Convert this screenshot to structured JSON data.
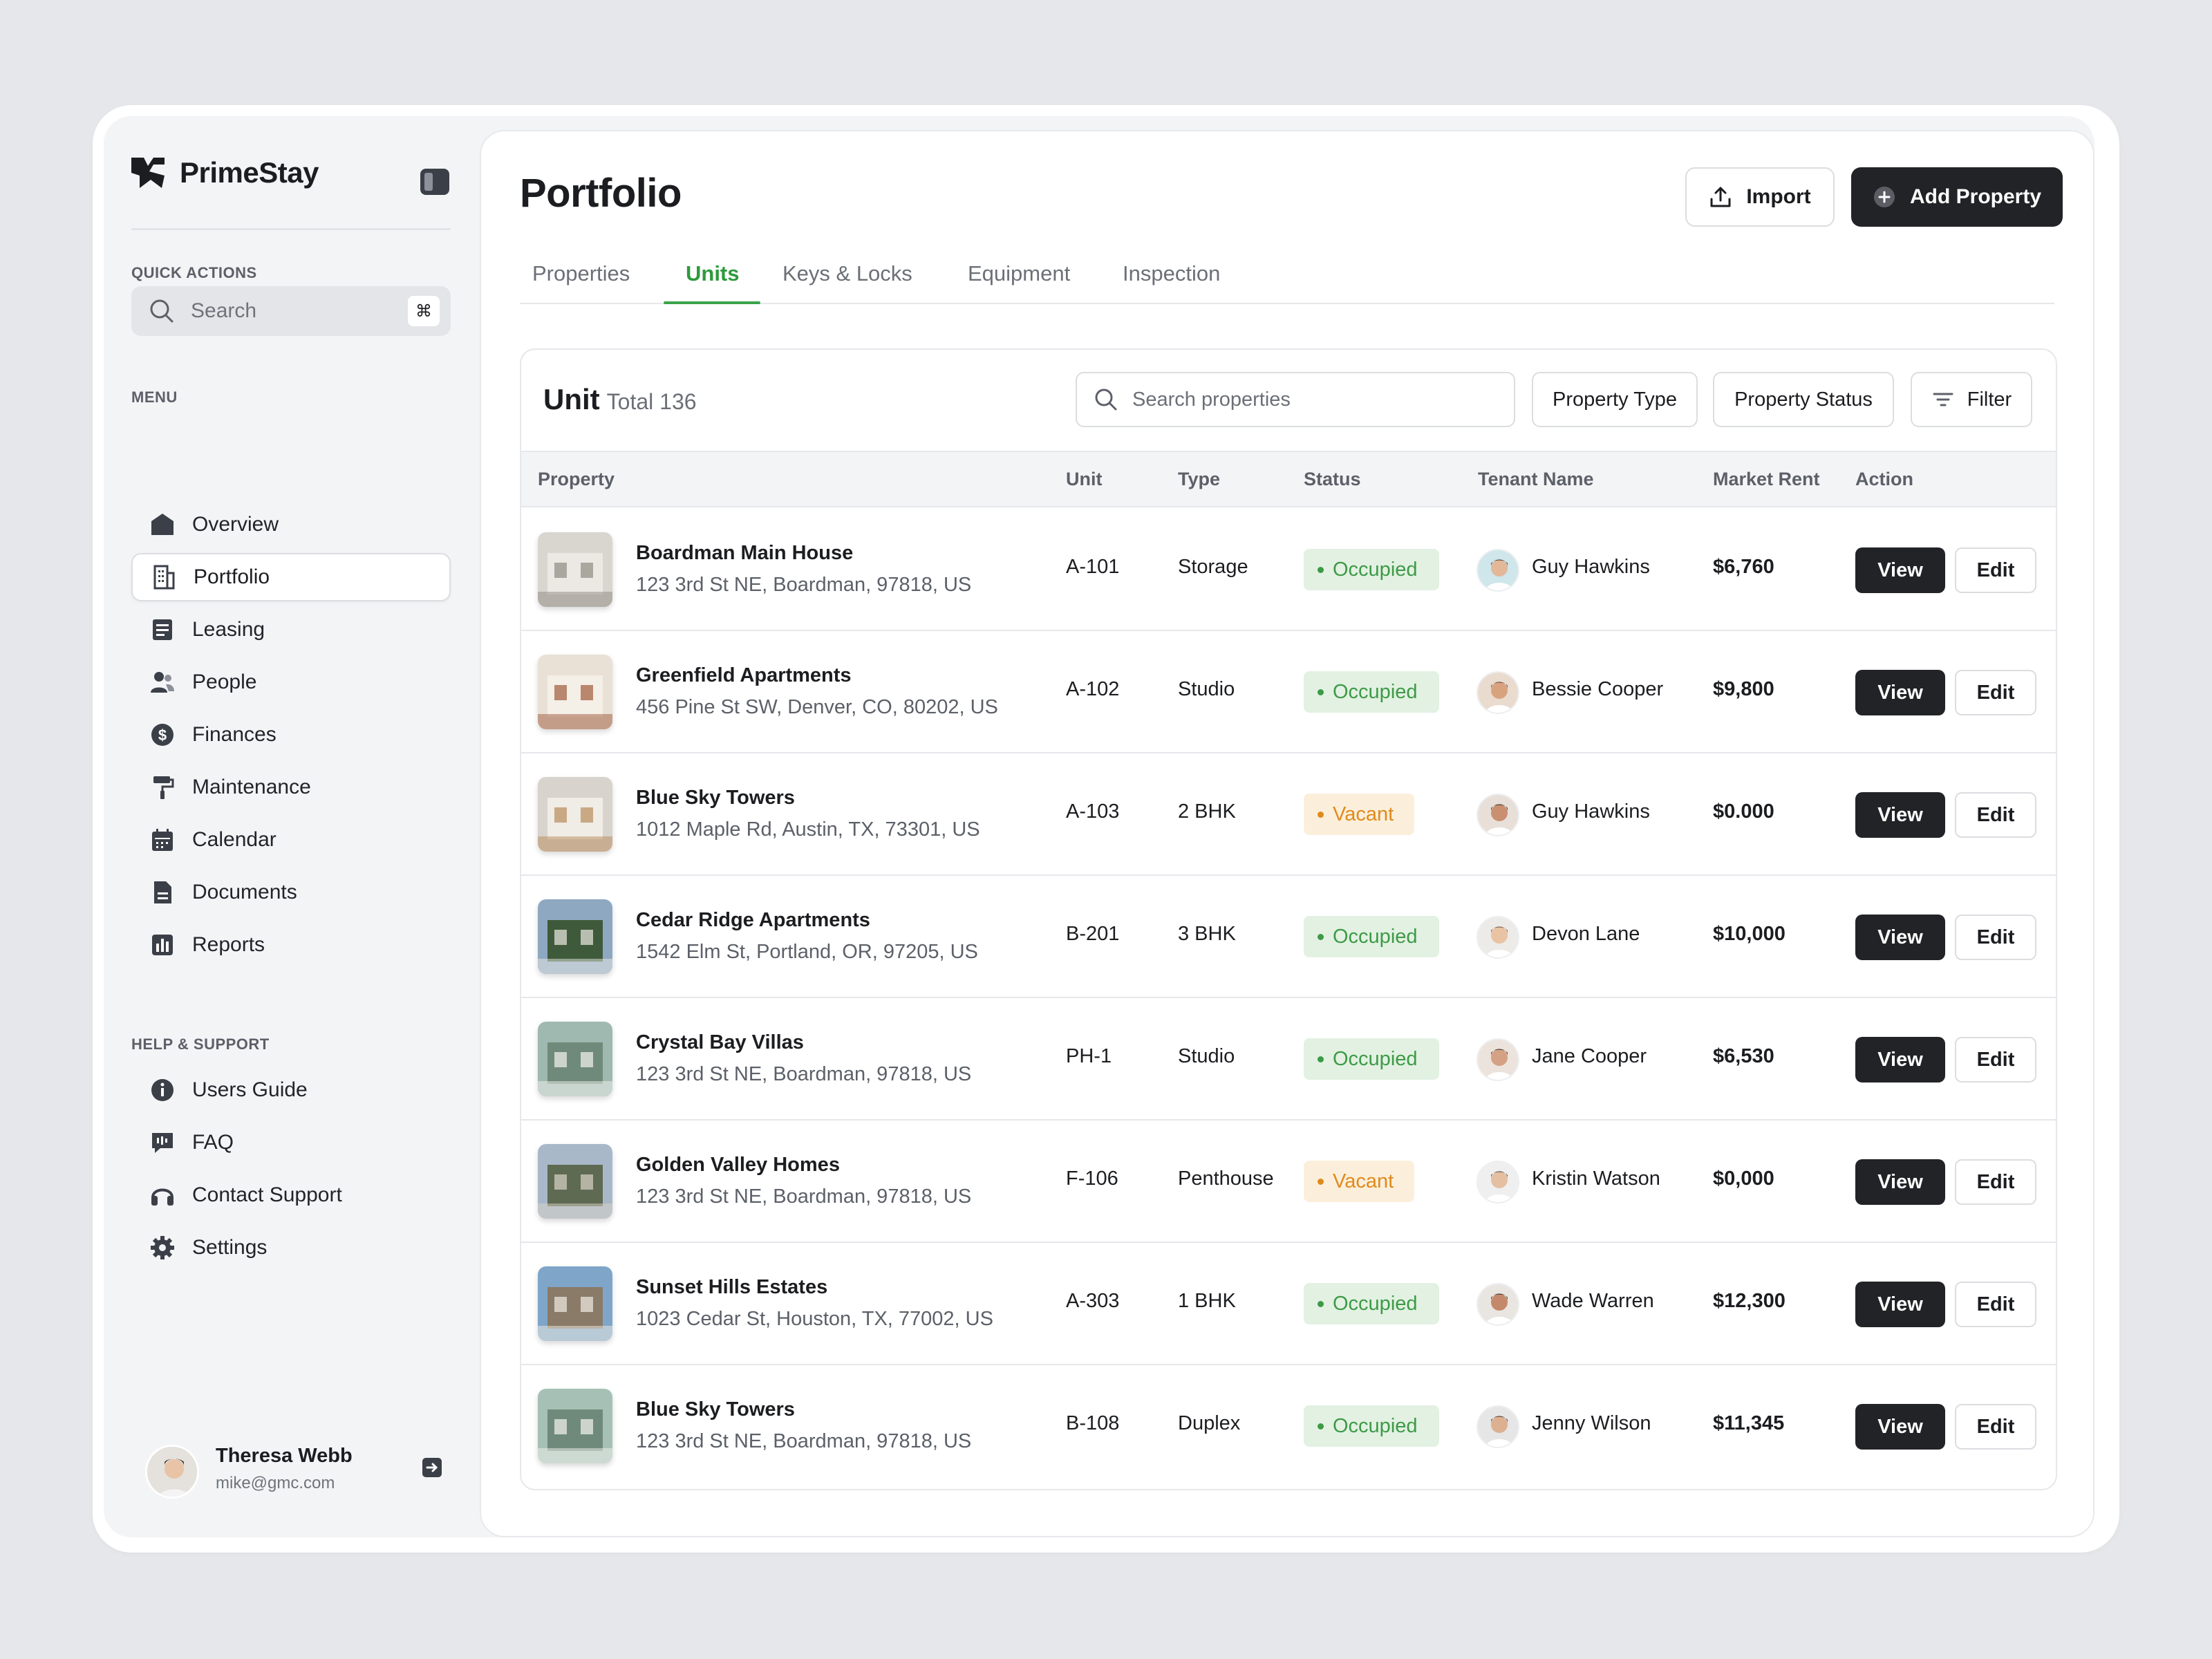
{
  "app": {
    "name": "PrimeStay"
  },
  "sidebar": {
    "quick_actions_label": "QUICK ACTIONS",
    "search_label": "Search",
    "search_shortcut": "⌘",
    "menu_label": "MENU",
    "menu": [
      {
        "label": "Overview",
        "icon": "home-icon"
      },
      {
        "label": "Portfolio",
        "icon": "building-icon",
        "active": true
      },
      {
        "label": "Leasing",
        "icon": "document-list-icon"
      },
      {
        "label": "People",
        "icon": "people-icon"
      },
      {
        "label": "Finances",
        "icon": "dollar-icon"
      },
      {
        "label": "Maintenance",
        "icon": "paint-roller-icon"
      },
      {
        "label": "Calendar",
        "icon": "calendar-icon"
      },
      {
        "label": "Documents",
        "icon": "file-icon"
      },
      {
        "label": "Reports",
        "icon": "bar-chart-icon"
      }
    ],
    "help_label": "HELP & SUPPORT",
    "help": [
      {
        "label": "Users Guide",
        "icon": "info-icon"
      },
      {
        "label": "FAQ",
        "icon": "chat-icon"
      },
      {
        "label": "Contact Support",
        "icon": "headset-icon"
      },
      {
        "label": "Settings",
        "icon": "gear-icon"
      }
    ],
    "user": {
      "name": "Theresa Webb",
      "email": "mike@gmc.com"
    }
  },
  "header": {
    "title": "Portfolio",
    "import_label": "Import",
    "add_label": "Add Property"
  },
  "tabs": [
    {
      "label": "Properties"
    },
    {
      "label": "Units",
      "active": true
    },
    {
      "label": "Keys & Locks"
    },
    {
      "label": "Equipment"
    },
    {
      "label": "Inspection"
    }
  ],
  "table": {
    "title": "Unit",
    "total": "Total 136",
    "search_placeholder": "Search properties",
    "filter_property_type": "Property Type",
    "filter_property_status": "Property Status",
    "filter_label": "Filter",
    "columns": [
      "Property",
      "Unit",
      "Type",
      "Status",
      "Tenant Name",
      "Market Rent",
      "Action"
    ],
    "view_label": "View",
    "edit_label": "Edit",
    "rows": [
      {
        "name": "Boardman Main House",
        "address": "123 3rd St NE, Boardman, 97818, US",
        "unit": "A-101",
        "type": "Storage",
        "status": "Occupied",
        "tenant": "Guy Hawkins",
        "rent": "$6,760"
      },
      {
        "name": "Greenfield Apartments",
        "address": "456 Pine St SW, Denver, CO, 80202, US",
        "unit": "A-102",
        "type": "Studio",
        "status": "Occupied",
        "tenant": "Bessie Cooper",
        "rent": "$9,800"
      },
      {
        "name": "Blue Sky Towers",
        "address": "1012 Maple Rd, Austin, TX, 73301, US",
        "unit": "A-103",
        "type": "2 BHK",
        "status": "Vacant",
        "tenant": "Guy Hawkins",
        "rent": "$0.000"
      },
      {
        "name": "Cedar Ridge Apartments",
        "address": "1542 Elm St, Portland, OR, 97205, US",
        "unit": "B-201",
        "type": "3 BHK",
        "status": "Occupied",
        "tenant": "Devon Lane",
        "rent": "$10,000"
      },
      {
        "name": "Crystal Bay Villas",
        "address": "123 3rd St NE, Boardman, 97818, US",
        "unit": "PH-1",
        "type": "Studio",
        "status": "Occupied",
        "tenant": "Jane Cooper",
        "rent": "$6,530"
      },
      {
        "name": "Golden Valley Homes",
        "address": "123 3rd St NE, Boardman, 97818, US",
        "unit": "F-106",
        "type": "Penthouse",
        "status": "Vacant",
        "tenant": "Kristin Watson",
        "rent": "$0,000"
      },
      {
        "name": "Sunset Hills Estates",
        "address": "1023 Cedar St, Houston, TX, 77002, US",
        "unit": "A-303",
        "type": "1 BHK",
        "status": "Occupied",
        "tenant": "Wade Warren",
        "rent": "$12,300"
      },
      {
        "name": "Blue Sky Towers",
        "address": "123 3rd St NE, Boardman, 97818, US",
        "unit": "B-108",
        "type": "Duplex",
        "status": "Occupied",
        "tenant": "Jenny Wilson",
        "rent": "$11,345"
      }
    ]
  },
  "colors": {
    "accent": "#3aa449",
    "occupied": "#3d9a46",
    "vacant": "#e08a1c",
    "dark": "#222326"
  }
}
